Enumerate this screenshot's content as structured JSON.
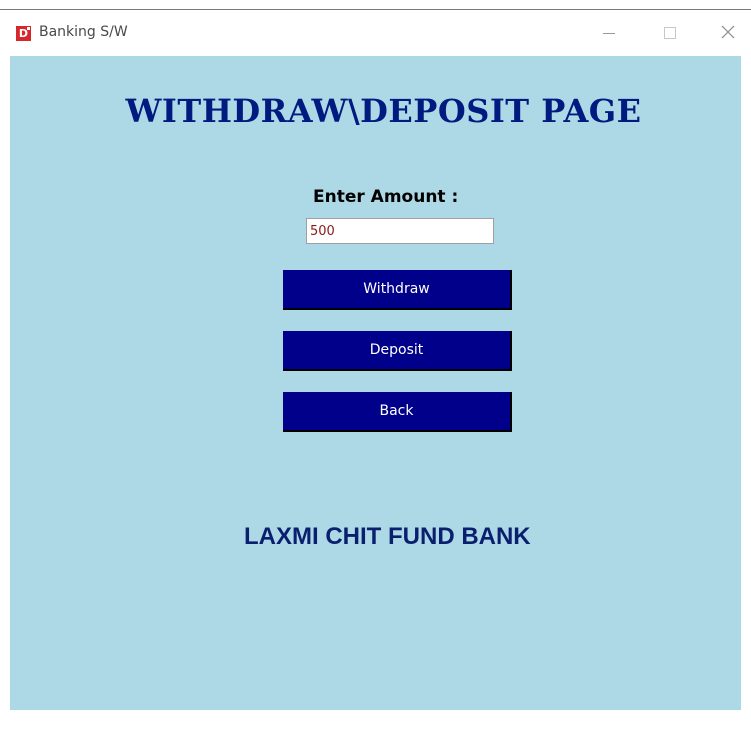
{
  "window": {
    "title": "Banking S/W",
    "icon_letter": "D",
    "controls": {
      "minimize": "minimize-icon",
      "maximize": "maximize-icon",
      "close": "close-icon"
    }
  },
  "page": {
    "heading": "WITHDRAW\\DEPOSIT PAGE",
    "amount_label": "Enter Amount :",
    "amount_value": "500",
    "buttons": {
      "withdraw": "Withdraw",
      "deposit": "Deposit",
      "back": "Back"
    },
    "bank_name": "LAXMI CHIT FUND BANK"
  },
  "colors": {
    "background": "#add8e6",
    "heading": "#001a80",
    "button": "#00008b",
    "button_text": "#ffffff",
    "bank_name": "#0a1f6e",
    "app_icon": "#d6282c"
  }
}
